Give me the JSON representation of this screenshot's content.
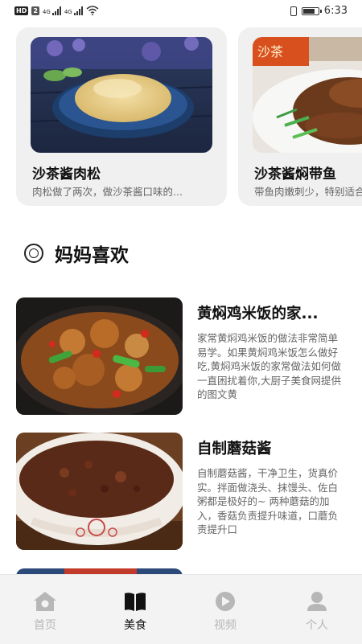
{
  "status_bar": {
    "hd_badge": "HD",
    "sim_badge": "2",
    "net1": "4G",
    "net2": "4G",
    "time": "6:33",
    "battery_level": 0.8
  },
  "featured": [
    {
      "title": "沙茶酱肉松",
      "desc": "肉松做了两次，做沙茶酱口味的..."
    },
    {
      "title": "沙茶酱焖带鱼",
      "desc": "带鱼肉嫩刺少，特别适合"
    }
  ],
  "section": {
    "title": "妈妈喜欢"
  },
  "list": [
    {
      "title": "黄焖鸡米饭的家...",
      "desc": "家常黄焖鸡米饭的做法非常简单易学。如果黄焖鸡米饭怎么做好吃,黄焖鸡米饭的家常做法如何做一直困扰着你,大厨子美食网提供的图文黄"
    },
    {
      "title": "自制蘑菇酱",
      "desc": "自制蘑菇酱，干净卫生，货真价实。拌面做浇头、抹馒头、佐白粥都是极好的~ 两种蘑菇的加入，香菇负责提升味道，口蘑负责提升口"
    }
  ],
  "tabs": [
    {
      "label": "首页",
      "icon": "home-icon",
      "active": false
    },
    {
      "label": "美食",
      "icon": "book-icon",
      "active": true
    },
    {
      "label": "视频",
      "icon": "video-play-icon",
      "active": false
    },
    {
      "label": "个人",
      "icon": "person-icon",
      "active": false
    }
  ],
  "colors": {
    "card_bg": "#f0f0f0",
    "tabbar_bg": "#f3f3f3",
    "tab_inactive": "#b7b7b7",
    "tab_active": "#111111",
    "desc_text": "#666666"
  }
}
